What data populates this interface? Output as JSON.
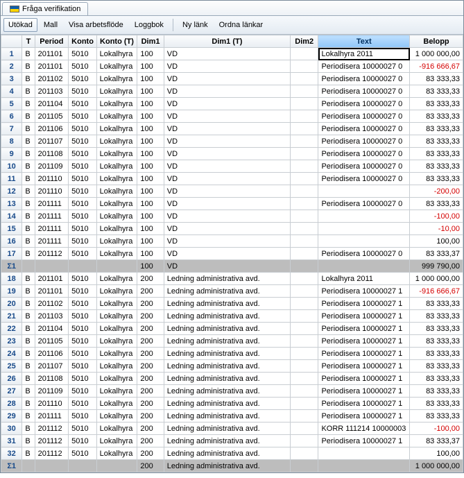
{
  "tab_title": "Fråga verifikation",
  "toolbar": {
    "utokad": "Utökad",
    "mall": "Mall",
    "visa": "Visa arbetsflöde",
    "loggbok": "Loggbok",
    "nylank": "Ny länk",
    "ordna": "Ordna länkar"
  },
  "headers": {
    "t": "T",
    "period": "Period",
    "konto": "Konto",
    "konto_t": "Konto (T)",
    "dim1": "Dim1",
    "dim1_t": "Dim1 (T)",
    "dim2": "Dim2",
    "text": "Text",
    "belopp": "Belopp"
  },
  "rows": [
    {
      "n": "1",
      "t": "B",
      "period": "201101",
      "konto": "5010",
      "konto_t": "Lokalhyra",
      "dim1": "100",
      "dim1_t": "VD",
      "dim2": "",
      "text": "Lokalhyra 2011",
      "belopp": "1 000 000,00",
      "editing": true
    },
    {
      "n": "2",
      "t": "B",
      "period": "201101",
      "konto": "5010",
      "konto_t": "Lokalhyra",
      "dim1": "100",
      "dim1_t": "VD",
      "dim2": "",
      "text": "Periodisera 10000027 0",
      "belopp": "-916 666,67",
      "neg": true
    },
    {
      "n": "3",
      "t": "B",
      "period": "201102",
      "konto": "5010",
      "konto_t": "Lokalhyra",
      "dim1": "100",
      "dim1_t": "VD",
      "dim2": "",
      "text": "Periodisera 10000027 0",
      "belopp": "83 333,33"
    },
    {
      "n": "4",
      "t": "B",
      "period": "201103",
      "konto": "5010",
      "konto_t": "Lokalhyra",
      "dim1": "100",
      "dim1_t": "VD",
      "dim2": "",
      "text": "Periodisera 10000027 0",
      "belopp": "83 333,33"
    },
    {
      "n": "5",
      "t": "B",
      "period": "201104",
      "konto": "5010",
      "konto_t": "Lokalhyra",
      "dim1": "100",
      "dim1_t": "VD",
      "dim2": "",
      "text": "Periodisera 10000027 0",
      "belopp": "83 333,33"
    },
    {
      "n": "6",
      "t": "B",
      "period": "201105",
      "konto": "5010",
      "konto_t": "Lokalhyra",
      "dim1": "100",
      "dim1_t": "VD",
      "dim2": "",
      "text": "Periodisera 10000027 0",
      "belopp": "83 333,33"
    },
    {
      "n": "7",
      "t": "B",
      "period": "201106",
      "konto": "5010",
      "konto_t": "Lokalhyra",
      "dim1": "100",
      "dim1_t": "VD",
      "dim2": "",
      "text": "Periodisera 10000027 0",
      "belopp": "83 333,33"
    },
    {
      "n": "8",
      "t": "B",
      "period": "201107",
      "konto": "5010",
      "konto_t": "Lokalhyra",
      "dim1": "100",
      "dim1_t": "VD",
      "dim2": "",
      "text": "Periodisera 10000027 0",
      "belopp": "83 333,33"
    },
    {
      "n": "9",
      "t": "B",
      "period": "201108",
      "konto": "5010",
      "konto_t": "Lokalhyra",
      "dim1": "100",
      "dim1_t": "VD",
      "dim2": "",
      "text": "Periodisera 10000027 0",
      "belopp": "83 333,33"
    },
    {
      "n": "10",
      "t": "B",
      "period": "201109",
      "konto": "5010",
      "konto_t": "Lokalhyra",
      "dim1": "100",
      "dim1_t": "VD",
      "dim2": "",
      "text": "Periodisera 10000027 0",
      "belopp": "83 333,33"
    },
    {
      "n": "11",
      "t": "B",
      "period": "201110",
      "konto": "5010",
      "konto_t": "Lokalhyra",
      "dim1": "100",
      "dim1_t": "VD",
      "dim2": "",
      "text": "Periodisera 10000027 0",
      "belopp": "83 333,33"
    },
    {
      "n": "12",
      "t": "B",
      "period": "201110",
      "konto": "5010",
      "konto_t": "Lokalhyra",
      "dim1": "100",
      "dim1_t": "VD",
      "dim2": "",
      "text": "",
      "belopp": "-200,00",
      "neg": true
    },
    {
      "n": "13",
      "t": "B",
      "period": "201111",
      "konto": "5010",
      "konto_t": "Lokalhyra",
      "dim1": "100",
      "dim1_t": "VD",
      "dim2": "",
      "text": "Periodisera 10000027 0",
      "belopp": "83 333,33"
    },
    {
      "n": "14",
      "t": "B",
      "period": "201111",
      "konto": "5010",
      "konto_t": "Lokalhyra",
      "dim1": "100",
      "dim1_t": "VD",
      "dim2": "",
      "text": "",
      "belopp": "-100,00",
      "neg": true
    },
    {
      "n": "15",
      "t": "B",
      "period": "201111",
      "konto": "5010",
      "konto_t": "Lokalhyra",
      "dim1": "100",
      "dim1_t": "VD",
      "dim2": "",
      "text": "",
      "belopp": "-10,00",
      "neg": true
    },
    {
      "n": "16",
      "t": "B",
      "period": "201111",
      "konto": "5010",
      "konto_t": "Lokalhyra",
      "dim1": "100",
      "dim1_t": "VD",
      "dim2": "",
      "text": "",
      "belopp": "100,00"
    },
    {
      "n": "17",
      "t": "B",
      "period": "201112",
      "konto": "5010",
      "konto_t": "Lokalhyra",
      "dim1": "100",
      "dim1_t": "VD",
      "dim2": "",
      "text": "Periodisera 10000027 0",
      "belopp": "83 333,37"
    },
    {
      "n": "Σ1",
      "sum": true,
      "dim1": "100",
      "dim1_t": "VD",
      "belopp": "999 790,00"
    },
    {
      "n": "18",
      "t": "B",
      "period": "201101",
      "konto": "5010",
      "konto_t": "Lokalhyra",
      "dim1": "200",
      "dim1_t": "Ledning administrativa avd.",
      "dim2": "",
      "text": "Lokalhyra 2011",
      "belopp": "1 000 000,00"
    },
    {
      "n": "19",
      "t": "B",
      "period": "201101",
      "konto": "5010",
      "konto_t": "Lokalhyra",
      "dim1": "200",
      "dim1_t": "Ledning administrativa avd.",
      "dim2": "",
      "text": "Periodisera 10000027 1",
      "belopp": "-916 666,67",
      "neg": true
    },
    {
      "n": "20",
      "t": "B",
      "period": "201102",
      "konto": "5010",
      "konto_t": "Lokalhyra",
      "dim1": "200",
      "dim1_t": "Ledning administrativa avd.",
      "dim2": "",
      "text": "Periodisera 10000027 1",
      "belopp": "83 333,33"
    },
    {
      "n": "21",
      "t": "B",
      "period": "201103",
      "konto": "5010",
      "konto_t": "Lokalhyra",
      "dim1": "200",
      "dim1_t": "Ledning administrativa avd.",
      "dim2": "",
      "text": "Periodisera 10000027 1",
      "belopp": "83 333,33"
    },
    {
      "n": "22",
      "t": "B",
      "period": "201104",
      "konto": "5010",
      "konto_t": "Lokalhyra",
      "dim1": "200",
      "dim1_t": "Ledning administrativa avd.",
      "dim2": "",
      "text": "Periodisera 10000027 1",
      "belopp": "83 333,33"
    },
    {
      "n": "23",
      "t": "B",
      "period": "201105",
      "konto": "5010",
      "konto_t": "Lokalhyra",
      "dim1": "200",
      "dim1_t": "Ledning administrativa avd.",
      "dim2": "",
      "text": "Periodisera 10000027 1",
      "belopp": "83 333,33"
    },
    {
      "n": "24",
      "t": "B",
      "period": "201106",
      "konto": "5010",
      "konto_t": "Lokalhyra",
      "dim1": "200",
      "dim1_t": "Ledning administrativa avd.",
      "dim2": "",
      "text": "Periodisera 10000027 1",
      "belopp": "83 333,33"
    },
    {
      "n": "25",
      "t": "B",
      "period": "201107",
      "konto": "5010",
      "konto_t": "Lokalhyra",
      "dim1": "200",
      "dim1_t": "Ledning administrativa avd.",
      "dim2": "",
      "text": "Periodisera 10000027 1",
      "belopp": "83 333,33"
    },
    {
      "n": "26",
      "t": "B",
      "period": "201108",
      "konto": "5010",
      "konto_t": "Lokalhyra",
      "dim1": "200",
      "dim1_t": "Ledning administrativa avd.",
      "dim2": "",
      "text": "Periodisera 10000027 1",
      "belopp": "83 333,33"
    },
    {
      "n": "27",
      "t": "B",
      "period": "201109",
      "konto": "5010",
      "konto_t": "Lokalhyra",
      "dim1": "200",
      "dim1_t": "Ledning administrativa avd.",
      "dim2": "",
      "text": "Periodisera 10000027 1",
      "belopp": "83 333,33"
    },
    {
      "n": "28",
      "t": "B",
      "period": "201110",
      "konto": "5010",
      "konto_t": "Lokalhyra",
      "dim1": "200",
      "dim1_t": "Ledning administrativa avd.",
      "dim2": "",
      "text": "Periodisera 10000027 1",
      "belopp": "83 333,33"
    },
    {
      "n": "29",
      "t": "B",
      "period": "201111",
      "konto": "5010",
      "konto_t": "Lokalhyra",
      "dim1": "200",
      "dim1_t": "Ledning administrativa avd.",
      "dim2": "",
      "text": "Periodisera 10000027 1",
      "belopp": "83 333,33"
    },
    {
      "n": "30",
      "t": "B",
      "period": "201112",
      "konto": "5010",
      "konto_t": "Lokalhyra",
      "dim1": "200",
      "dim1_t": "Ledning administrativa avd.",
      "dim2": "",
      "text": "KORR 111214 10000003",
      "belopp": "-100,00",
      "neg": true
    },
    {
      "n": "31",
      "t": "B",
      "period": "201112",
      "konto": "5010",
      "konto_t": "Lokalhyra",
      "dim1": "200",
      "dim1_t": "Ledning administrativa avd.",
      "dim2": "",
      "text": "Periodisera 10000027 1",
      "belopp": "83 333,37"
    },
    {
      "n": "32",
      "t": "B",
      "period": "201112",
      "konto": "5010",
      "konto_t": "Lokalhyra",
      "dim1": "200",
      "dim1_t": "Ledning administrativa avd.",
      "dim2": "",
      "text": "",
      "belopp": "100,00"
    },
    {
      "n": "Σ1",
      "sum": true,
      "dim1": "200",
      "dim1_t": "Ledning administrativa avd.",
      "belopp": "1 000 000,00"
    }
  ]
}
